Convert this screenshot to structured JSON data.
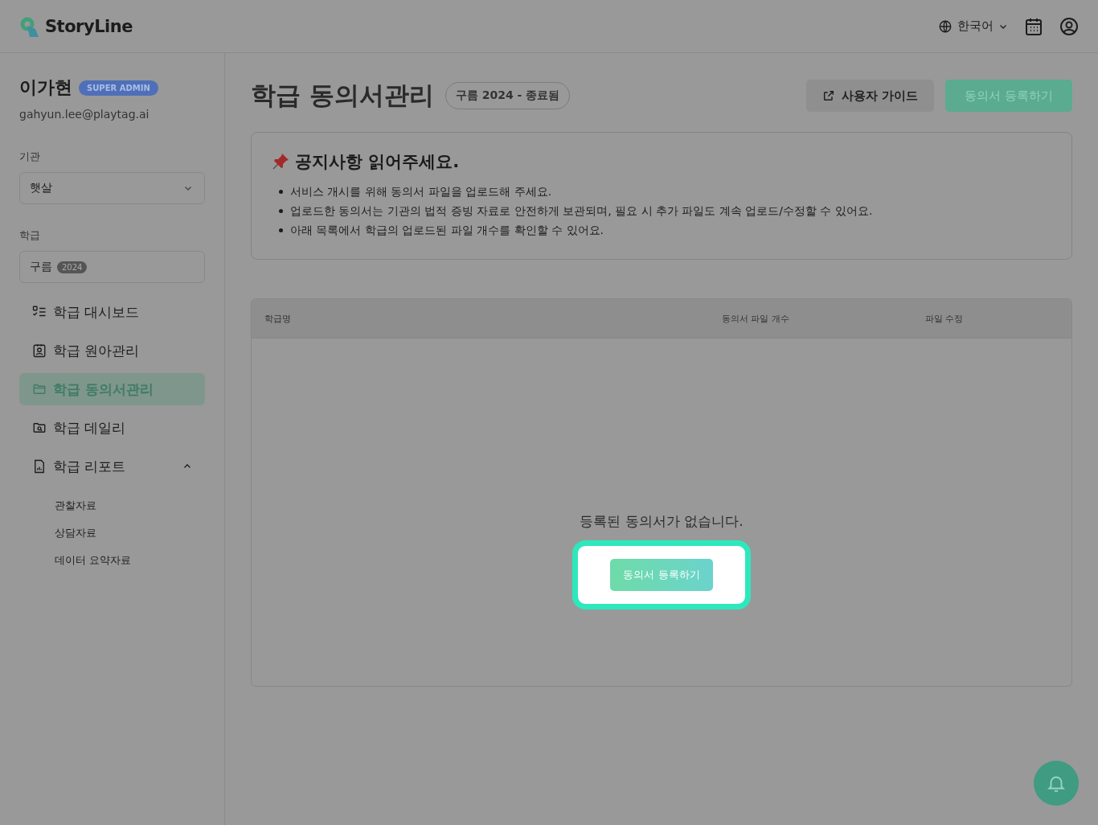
{
  "header": {
    "logo": "StoryLine",
    "language": "한국어"
  },
  "user": {
    "name": "이가현",
    "role": "SUPER ADMIN",
    "email": "gahyun.lee@playtag.ai"
  },
  "filters": [
    {
      "kind": "select",
      "label": "기관",
      "value": "햇살"
    },
    {
      "kind": "display",
      "label": "학급",
      "value": "구름",
      "tag": "2024"
    }
  ],
  "nav": [
    {
      "label": "학급 대시보드",
      "selected": false
    },
    {
      "label": "학급 원아관리",
      "selected": false
    },
    {
      "label": "학급 동의서관리",
      "selected": true
    },
    {
      "label": "학급 데일리",
      "selected": false
    },
    {
      "label": "학급 리포트",
      "selected": false,
      "expanded": true,
      "children": [
        {
          "label": "관찰자료"
        },
        {
          "label": "상담자료"
        },
        {
          "label": "데이터 요약자료"
        }
      ]
    }
  ],
  "page": {
    "title": "학급 동의서관리",
    "badge": "구름 2024 - 종료됨",
    "guide_button": "사용자 가이드",
    "register_button": "동의서 등록하기"
  },
  "notice": {
    "title": "공지사항 읽어주세요.",
    "items": [
      "서비스 개시를 위해 동의서 파일을 업로드해 주세요.",
      "업로드한 동의서는 기관의 법적 증빙 자료로 안전하게 보관되며, 필요 시 추가 파일도 계속 업로드/수정할 수 있어요.",
      "아래 목록에서 학급의 업로드된 파일 개수를 확인할 수 있어요."
    ]
  },
  "table": {
    "columns": [
      "학급명",
      "동의서 파일 개수",
      "파일 수정"
    ],
    "empty_message": "등록된 동의서가 없습니다.",
    "empty_button": "동의서 등록하기"
  }
}
